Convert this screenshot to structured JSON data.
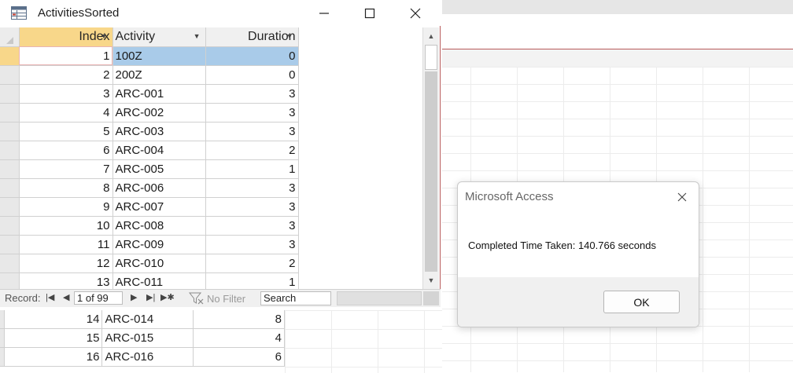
{
  "window": {
    "title": "ActivitiesSorted",
    "minimize_icon": "minimize-icon",
    "maximize_icon": "maximize-icon",
    "close_icon": "close-icon"
  },
  "datasheet": {
    "columns": [
      "Index",
      "Activity",
      "Duration"
    ],
    "rows": [
      {
        "index": "1",
        "activity": "100Z",
        "duration": "0"
      },
      {
        "index": "2",
        "activity": "200Z",
        "duration": "0"
      },
      {
        "index": "3",
        "activity": "ARC-001",
        "duration": "3"
      },
      {
        "index": "4",
        "activity": "ARC-002",
        "duration": "3"
      },
      {
        "index": "5",
        "activity": "ARC-003",
        "duration": "3"
      },
      {
        "index": "6",
        "activity": "ARC-004",
        "duration": "2"
      },
      {
        "index": "7",
        "activity": "ARC-005",
        "duration": "1"
      },
      {
        "index": "8",
        "activity": "ARC-006",
        "duration": "3"
      },
      {
        "index": "9",
        "activity": "ARC-007",
        "duration": "3"
      },
      {
        "index": "10",
        "activity": "ARC-008",
        "duration": "3"
      },
      {
        "index": "11",
        "activity": "ARC-009",
        "duration": "3"
      },
      {
        "index": "12",
        "activity": "ARC-010",
        "duration": "2"
      },
      {
        "index": "13",
        "activity": "ARC-011",
        "duration": "1"
      }
    ]
  },
  "navigation": {
    "record_label": "Record:",
    "position": "1 of 99",
    "filter_label": "No Filter",
    "search_placeholder": "Search"
  },
  "background_table": {
    "rows": [
      {
        "index": "14",
        "activity": "ARC-014",
        "duration": "8"
      },
      {
        "index": "15",
        "activity": "ARC-015",
        "duration": "4"
      },
      {
        "index": "16",
        "activity": "ARC-016",
        "duration": "6"
      }
    ]
  },
  "message_box": {
    "title": "Microsoft Access",
    "message": "Completed Time Taken: 140.766 seconds",
    "ok_label": "OK"
  },
  "colors": {
    "header_highlight": "#f8d78a",
    "selected_row": "#a9cbe9",
    "window_border": "#b85a5a"
  }
}
